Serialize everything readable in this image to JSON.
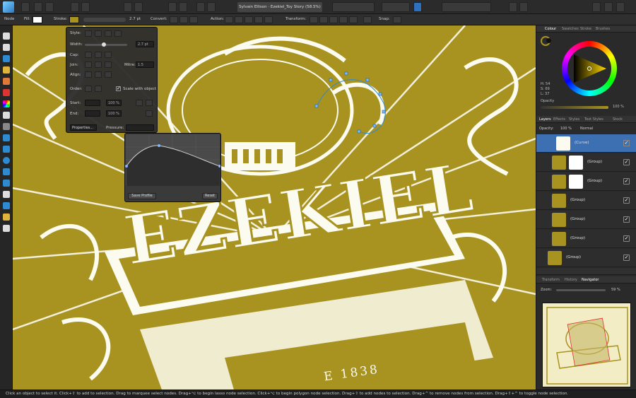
{
  "toolbar": {
    "document_title": "Sylvain Ellison · Ezekiel_Toy Story (58.5%)"
  },
  "context_bar": {
    "mode_label": "Node",
    "fill_label": "Fill:",
    "stroke_label": "Stroke:",
    "width_value": "2.7 pt",
    "convert_label": "Convert:",
    "action_label": "Action:",
    "transform_label": "Transform:",
    "snap_label": "Snap:"
  },
  "stroke_popover": {
    "style_label": "Style:",
    "width_label": "Width:",
    "width_value": "2.7 pt",
    "cap_label": "Cap:",
    "join_label": "Join:",
    "mitre_label": "Mitre:",
    "mitre_value": "1.5",
    "align_label": "Align:",
    "order_label": "Order:",
    "scale_label": "Scale with object",
    "start_label": "Start:",
    "start_value": "100 %",
    "end_label": "End:",
    "end_value": "100 %",
    "properties_label": "Properties...",
    "pressure_label": "Pressure:"
  },
  "pressure_popup": {
    "save_label": "Save Profile",
    "reset_label": "Reset"
  },
  "right_panel": {
    "color_tabs": [
      "Colour",
      "Swatches",
      "Stroke",
      "Brushes"
    ],
    "hsl_values": [
      "H: 54",
      "S: 69",
      "L: 37"
    ],
    "opacity_label": "Opacity",
    "opacity_value": "100 %",
    "layer_tabs": [
      "Layers",
      "Effects",
      "Styles",
      "Text Styles",
      "Stock"
    ],
    "layers_opacity_label": "Opacity:",
    "layers_opacity_value": "100 %",
    "blend_mode": "Normal",
    "layers": [
      {
        "name": "(Curve)"
      },
      {
        "name": "(Group)"
      },
      {
        "name": "(Group)"
      },
      {
        "name": "(Group)"
      },
      {
        "name": "(Group)"
      },
      {
        "name": "(Group)"
      },
      {
        "name": "(Group)"
      }
    ],
    "nav_tabs": [
      "Transform",
      "History",
      "Navigator"
    ],
    "zoom_label": "Zoom:",
    "zoom_value": "59 %"
  },
  "canvas": {
    "artwork_title": "EZEKIEL",
    "year_text": "E 1838",
    "colors": {
      "gold": "#a89220",
      "cream": "#fbfbf0"
    }
  },
  "status": {
    "hint": "Click an object to select it. Click+⇧ to add to selection. Drag to marquee select nodes. Drag+⌥ to begin lasso node selection. Click+⌥ to begin polygon node selection. Drag+⇧ to add nodes to selection. Drag+^ to remove nodes from selection. Drag+⇧+^ to toggle node selection."
  }
}
